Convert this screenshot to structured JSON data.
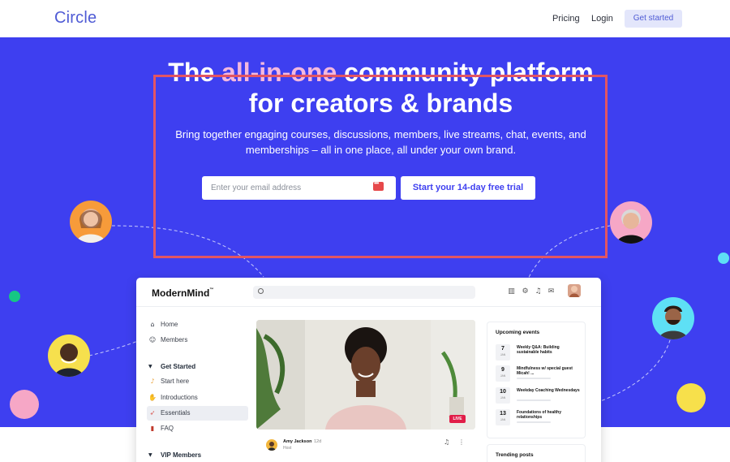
{
  "topnav": {
    "logo": "Circle",
    "links": [
      "Pricing",
      "Login"
    ],
    "cta": "Get started"
  },
  "hero": {
    "headline_before": "The ",
    "headline_accent": "all-in-one",
    "headline_after": " community platform for creators & brands",
    "subhead": "Bring together engaging courses, discussions, members, live streams, chat, events, and memberships – all in one place, all under your own brand.",
    "email_placeholder": "Enter your email address",
    "trial_button": "Start your 14-day free trial"
  },
  "colors": {
    "hero_bg": "#3e3ff0",
    "accent_text": "#f3b8de",
    "logo": "#4f5bd5",
    "highlight_border": "#e25563"
  },
  "app": {
    "brand": "ModernMind",
    "brand_mark": "™",
    "sidebar": {
      "items": [
        {
          "label": "Home",
          "icon": "home-icon"
        },
        {
          "label": "Members",
          "icon": "members-icon"
        }
      ],
      "sections": [
        {
          "title": "Get Started",
          "items": [
            {
              "label": "Start here",
              "icon": "headphones-icon"
            },
            {
              "label": "Introductions",
              "icon": "wave-icon"
            },
            {
              "label": "Essentials",
              "icon": "rocket-icon",
              "active": true
            },
            {
              "label": "FAQ",
              "icon": "book-icon"
            }
          ]
        },
        {
          "title": "VIP Members",
          "items": []
        }
      ]
    },
    "video": {
      "live_badge": "LIVE"
    },
    "post": {
      "author": "Amy Jackson",
      "time": "12d",
      "role": "Host"
    },
    "events": {
      "title": "Upcoming events",
      "items": [
        {
          "day": "7",
          "month": "JAN",
          "title": "Weekly Q&A: Building sustainable habits"
        },
        {
          "day": "9",
          "month": "JAN",
          "title": "Mindfulness w/ special guest Micah! ..."
        },
        {
          "day": "10",
          "month": "JAN",
          "title": "Weekday Coaching Wednesdays"
        },
        {
          "day": "13",
          "month": "JAN",
          "title": "Foundations of healthy relationships"
        }
      ]
    },
    "trending": {
      "title": "Trending posts"
    }
  }
}
